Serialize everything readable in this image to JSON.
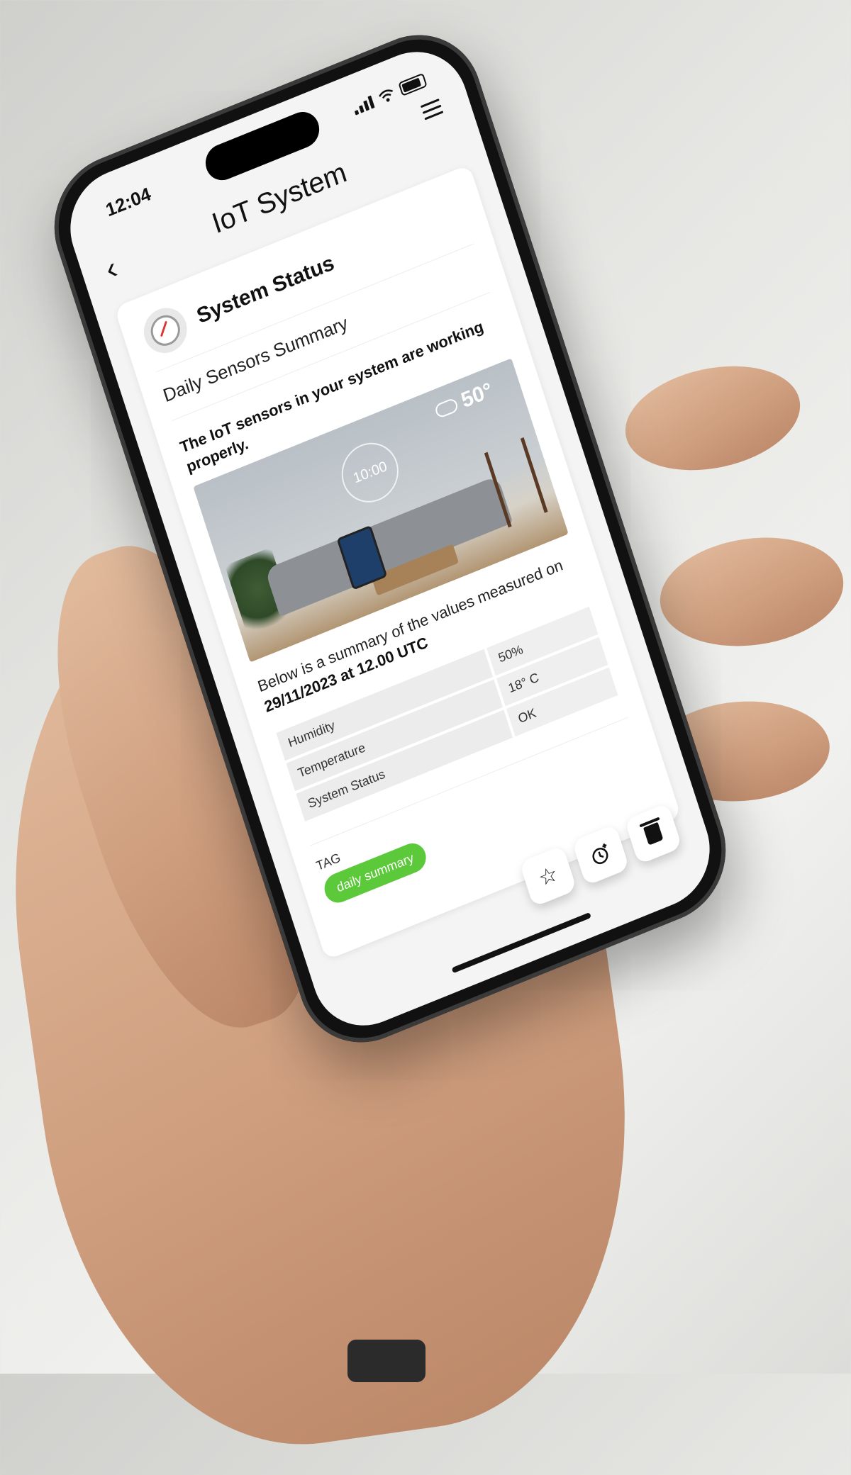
{
  "status_bar": {
    "time": "12:04"
  },
  "header": {
    "title": "IoT System",
    "back_icon": "chevron-left-icon",
    "menu_icon": "hamburger-menu-icon"
  },
  "card": {
    "title": "System Status",
    "avatar_icon": "compass-icon",
    "subtitle": "Daily Sensors Summary",
    "message": "The IoT sensors in your system are working properly.",
    "photo": {
      "clock_text": "10:00",
      "weather_temp": "50°"
    },
    "summary_prefix": "Below is a summary of the values measured on",
    "summary_date": "29/11/2023 at 12.00 UTC",
    "rows": [
      {
        "label": "Humidity",
        "value": "50%"
      },
      {
        "label": "Temperature",
        "value": "18° C"
      },
      {
        "label": "System Status",
        "value": "OK"
      }
    ],
    "tag_label": "TAG",
    "tag_chip": "daily summary"
  },
  "actions": {
    "star_icon": "star-icon",
    "snooze_icon": "snooze-clock-icon",
    "trash_icon": "trash-icon"
  },
  "colors": {
    "tag_green": "#5cc93a",
    "screen_bg": "#f4f4f4"
  }
}
